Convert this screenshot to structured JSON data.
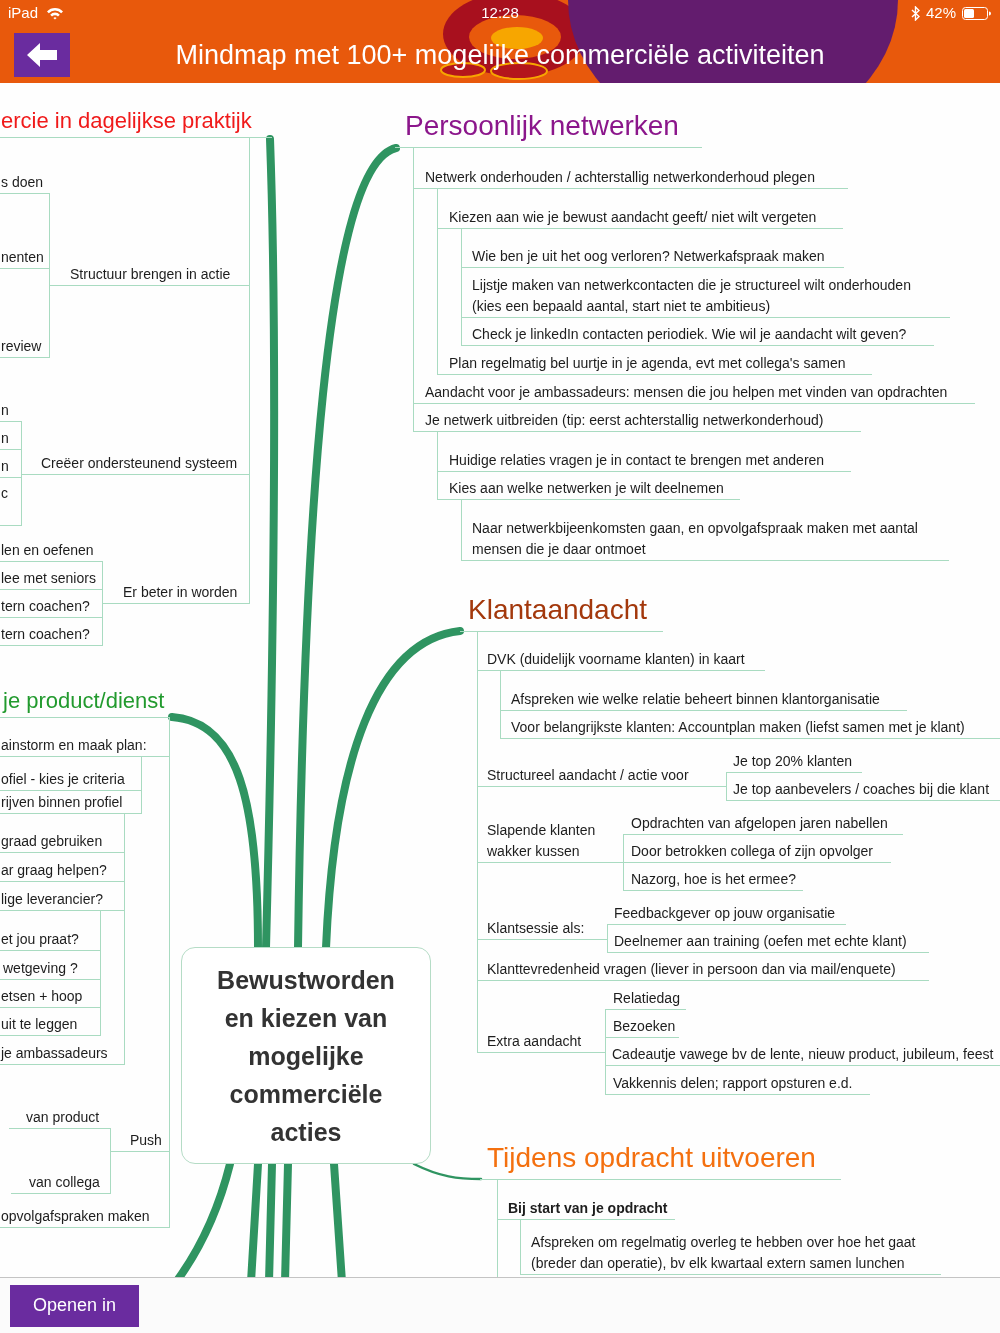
{
  "status_bar": {
    "device": "iPad",
    "time": "12:28",
    "battery": "42%"
  },
  "header": {
    "title": "Mindmap met 100+ mogelijke commerciële activiteiten"
  },
  "mindmap": {
    "central_topic": "Bewustworden en kiezen van mogelijke commerciële acties",
    "branches": [
      {
        "title": "ercie in dagelijkse praktijk",
        "color": "#f01a1a",
        "children": [
          {
            "text": "Structuur brengen in actie",
            "children": [
              {
                "text": "s doen"
              },
              {
                "text": "nenten"
              },
              {
                "text": "review"
              }
            ]
          },
          {
            "text": "Creëer ondersteunend systeem",
            "children": [
              {
                "text": "n"
              },
              {
                "text": "n"
              },
              {
                "text": "n"
              },
              {
                "text": "c"
              }
            ]
          },
          {
            "text": "Er beter in worden",
            "children": [
              {
                "text": "len en oefenen"
              },
              {
                "text": "lee met seniors"
              },
              {
                "text": "tern coachen?"
              },
              {
                "text": "tern coachen?"
              }
            ]
          }
        ]
      },
      {
        "title": "Persoonlijk netwerken",
        "color": "#8b168b",
        "children": [
          {
            "text": "Netwerk onderhouden / achterstallig netwerkonderhoud plegen",
            "children": [
              {
                "text": "Kiezen aan wie je bewust aandacht geeft/ niet wilt vergeten",
                "children": [
                  {
                    "text": "Wie ben je uit het oog verloren? Netwerkafspraak maken"
                  },
                  {
                    "text": "Lijstje maken van netwerkcontacten die je structureel wilt onderhouden (kies een bepaald aantal, start niet te ambitieus)"
                  },
                  {
                    "text": "Check je linkedIn contacten periodiek. Wie wil je aandacht wilt geven?"
                  }
                ]
              },
              {
                "text": "Plan regelmatig bel uurtje in je agenda, evt met collega's samen"
              }
            ]
          },
          {
            "text": "Aandacht voor je ambassadeurs: mensen die jou helpen met vinden van opdrachten"
          },
          {
            "text": "Je netwerk uitbreiden (tip: eerst achterstallig netwerkonderhoud)",
            "children": [
              {
                "text": "Huidige relaties vragen je in contact te brengen met anderen"
              },
              {
                "text": "Kies aan welke netwerken je wilt deelnemen",
                "children": [
                  {
                    "text": "Naar netwerkbijeenkomsten gaan, en opvolgafspraak maken met aantal mensen die je daar ontmoet"
                  }
                ]
              }
            ]
          }
        ]
      },
      {
        "title": "Klantaandacht",
        "color": "#a3380c",
        "children": [
          {
            "text": "DVK (duidelijk voorname klanten) in kaart",
            "children": [
              {
                "text": "Afspreken wie welke relatie beheert binnen klantorganisatie"
              },
              {
                "text": "Voor belangrijkste klanten: Accountplan maken (liefst samen met je klant)"
              }
            ]
          },
          {
            "text": "Structureel aandacht / actie voor",
            "children": [
              {
                "text": "Je top 20% klanten"
              },
              {
                "text": "Je top aanbevelers / coaches bij die klant"
              }
            ]
          },
          {
            "text": "Slapende klanten wakker kussen",
            "children": [
              {
                "text": "Opdrachten van afgelopen jaren nabellen"
              },
              {
                "text": "Door betrokken collega of zijn opvolger"
              },
              {
                "text": "Nazorg, hoe is het ermee?"
              }
            ]
          },
          {
            "text": "Klantsessie als:",
            "children": [
              {
                "text": "Feedbackgever op jouw organisatie"
              },
              {
                "text": "Deelnemer aan training (oefen met echte klant)"
              }
            ]
          },
          {
            "text": "Klanttevredenheid vragen (liever in persoon dan via mail/enquete)"
          },
          {
            "text": "Extra aandacht",
            "children": [
              {
                "text": "Relatiedag"
              },
              {
                "text": "Bezoeken"
              },
              {
                "text": "Cadeautje vawege bv de lente, nieuw product, jubileum, feest"
              },
              {
                "text": "Vakkennis delen; rapport opsturen e.d."
              }
            ]
          }
        ]
      },
      {
        "title": "je product/dienst",
        "color": "#229a2e",
        "children": [
          {
            "text": "ainstorm en maak plan:",
            "children": [
              {
                "text": "ofiel - kies je criteria"
              },
              {
                "text": "rijven binnen profiel",
                "children": [
                  {
                    "text": "graad gebruiken"
                  },
                  {
                    "text": "ar graag helpen?"
                  },
                  {
                    "text": "lige leverancier?",
                    "children": [
                      {
                        "text": "et jou praat?"
                      },
                      {
                        "text": "wetgeving ?"
                      },
                      {
                        "text": "etsen + hoop"
                      },
                      {
                        "text": "uit te leggen"
                      }
                    ]
                  },
                  {
                    "text": "je ambassadeurs"
                  }
                ]
              }
            ]
          },
          {
            "text": "Push",
            "children": [
              {
                "text": "van product"
              },
              {
                "text": "van collega"
              }
            ]
          },
          {
            "text": "opvolgafspraken maken"
          }
        ]
      },
      {
        "title": "Tijdens opdracht uitvoeren",
        "color": "#f4700f",
        "children": [
          {
            "text": "Bij start van je opdracht",
            "children": [
              {
                "text": "Afspreken om regelmatig overleg te hebben over hoe het gaat (breder dan operatie), bv elk kwartaal extern samen lunchen"
              }
            ]
          }
        ]
      }
    ]
  },
  "footer": {
    "button": "Openen in"
  }
}
